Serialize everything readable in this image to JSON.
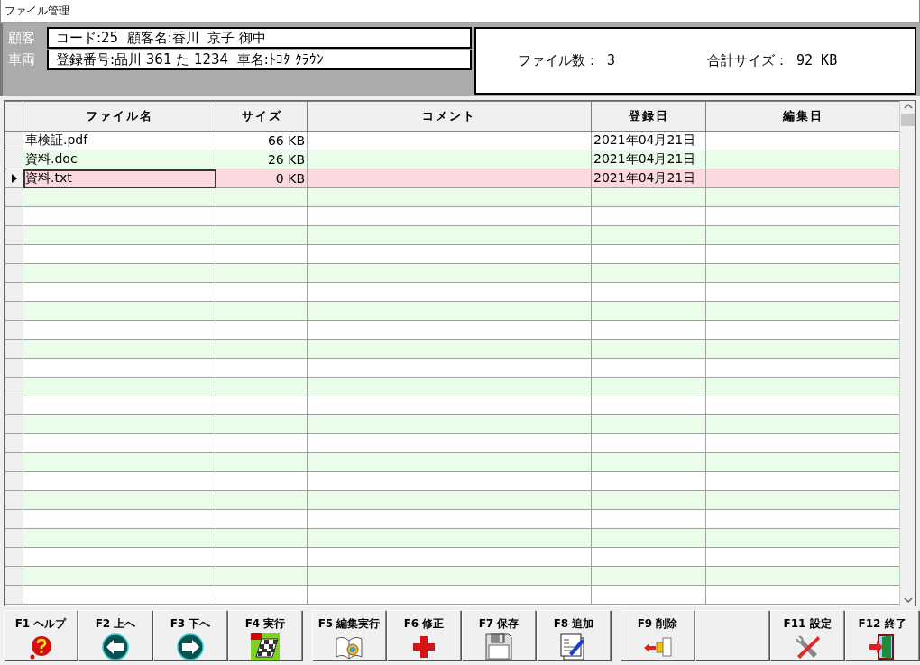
{
  "window": {
    "title": "ファイル管理"
  },
  "header": {
    "fields": [
      {
        "label": "顧客",
        "value": "コード:25  顧客名:香川  京子 御中"
      },
      {
        "label": "車両",
        "value": "登録番号:品川 361 た 1234  車名:ﾄﾖﾀ ｸﾗｳﾝ"
      }
    ],
    "summary": [
      "ファイル数： 3",
      "合計サイズ： 92 KB"
    ]
  },
  "table": {
    "columns": [
      "ファイル名",
      "サイズ",
      "コメント",
      "登録日",
      "編集日"
    ],
    "rows": [
      {
        "file_name": "車検証.pdf",
        "size": "66 KB",
        "registered": "2021年04月21日",
        "selected": false
      },
      {
        "file_name": "資料.doc",
        "size": "26 KB",
        "registered": "2021年04月21日",
        "selected": false
      },
      {
        "file_name": "資料.txt",
        "size": "0 KB",
        "registered": "2021年04月21日",
        "selected": true
      }
    ]
  },
  "button_groups": [
    [
      {
        "kind": "function",
        "label": "F1 ヘルプ"
      },
      {
        "kind": "function",
        "label": "F2 上へ"
      },
      {
        "kind": "function",
        "label": "F3 下へ"
      },
      {
        "kind": "function",
        "label": "F4 実行"
      }
    ],
    [
      {
        "kind": "function",
        "label": "F5 編集実行"
      },
      {
        "kind": "function",
        "label": "F6 修正"
      },
      {
        "kind": "function",
        "label": "F7 保存"
      },
      {
        "kind": "function",
        "label": "F8 追加"
      }
    ],
    [
      {
        "kind": "function",
        "label": "F9 削除"
      },
      {
        "kind": "blank"
      },
      {
        "kind": "function",
        "label": "F11 設定"
      },
      {
        "kind": "function",
        "label": "F12 終了"
      }
    ]
  ]
}
